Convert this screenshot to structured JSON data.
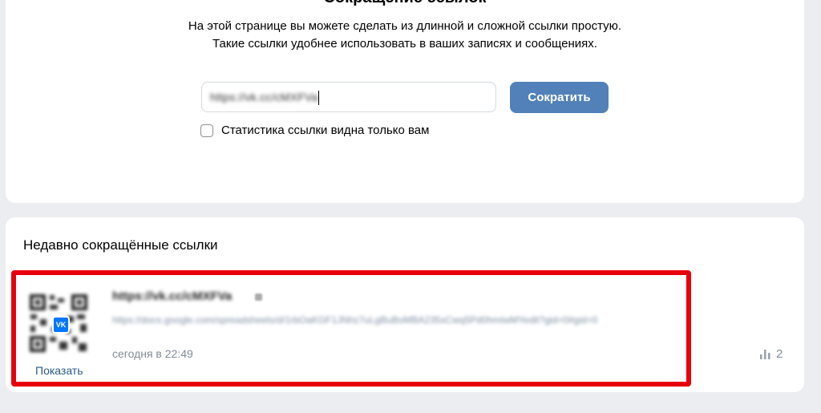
{
  "top": {
    "heading_partial": "Сокращение ссылок",
    "intro_line1": "На этой странице вы можете сделать из длинной и сложной ссылки простую.",
    "intro_line2": "Такие ссылки удобнее использовать в ваших записях и сообщениях.",
    "url_input_value": "https://vk.cc/cMXFVa",
    "shorten_label": "Сократить",
    "stats_private_label": "Статистика ссылки видна только вам"
  },
  "recent": {
    "title": "Недавно сокращённые ссылки",
    "items": [
      {
        "short_url": "https://vk.cc/cMXFVa",
        "long_url": "https://docs.google.com/spreadsheets/d/1rbOaKGF1JNhz7uLgBuBoMBA235xCwq5Pd0hmIwMYedit?gid=0#gid=0",
        "timestamp": "сегодня в 22:49",
        "qr_badge": "VK",
        "show_label": "Показать",
        "clicks": "2",
        "clicks_icon": "bar-chart-icon"
      }
    ]
  },
  "colors": {
    "background": "#ebedf0",
    "button": "#5181b8",
    "highlight": "#e8000d",
    "link": "#2a5885",
    "muted": "#818c99"
  }
}
